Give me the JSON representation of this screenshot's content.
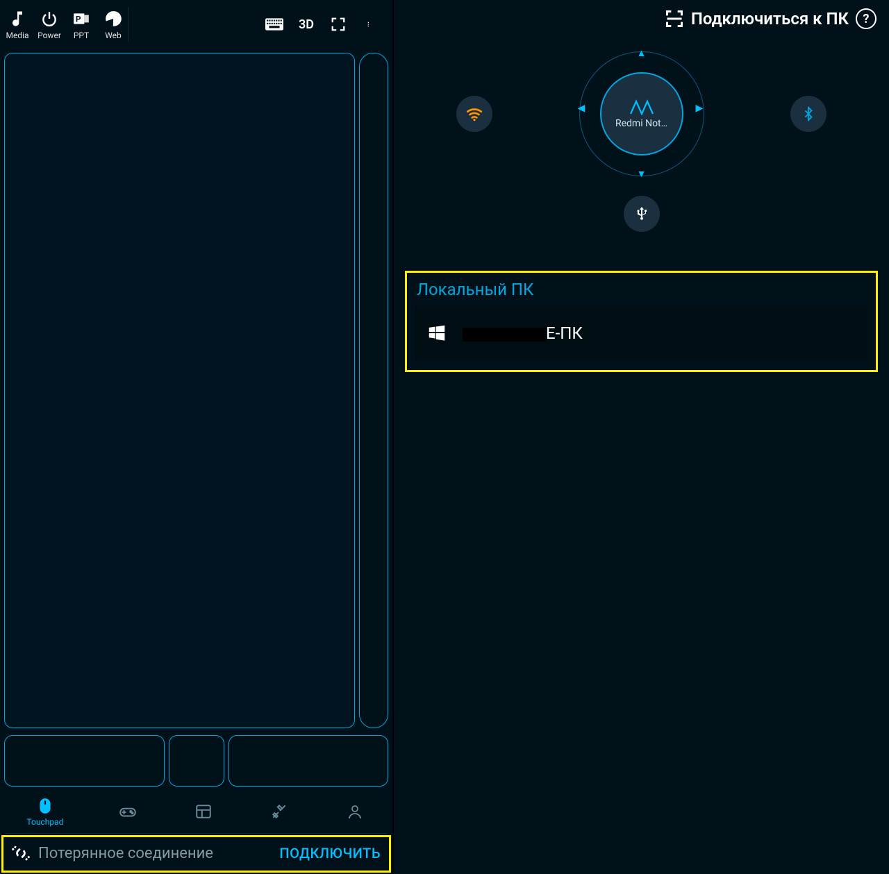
{
  "left": {
    "toolbar": {
      "items": [
        {
          "id": "media",
          "label": "Media"
        },
        {
          "id": "power",
          "label": "Power"
        },
        {
          "id": "ppt",
          "label": "PPT"
        },
        {
          "id": "web",
          "label": "Web"
        }
      ],
      "right": {
        "keyboard": "keyboard-icon",
        "threeD": "3D",
        "fullscreen": "fullscreen-icon",
        "more": "more-icon"
      }
    },
    "bottom_nav": {
      "touchpad_label": "Touchpad"
    },
    "status": {
      "text": "Потерянное соединение",
      "button": "ПОДКЛЮЧИТЬ"
    }
  },
  "right": {
    "header": {
      "title": "Подключиться к ПК",
      "help": "?"
    },
    "radar": {
      "device_name": "Redmi Not…"
    },
    "local_pc": {
      "header": "Локальный ПК",
      "items": [
        {
          "name_suffix": "E-ПК"
        }
      ]
    }
  }
}
